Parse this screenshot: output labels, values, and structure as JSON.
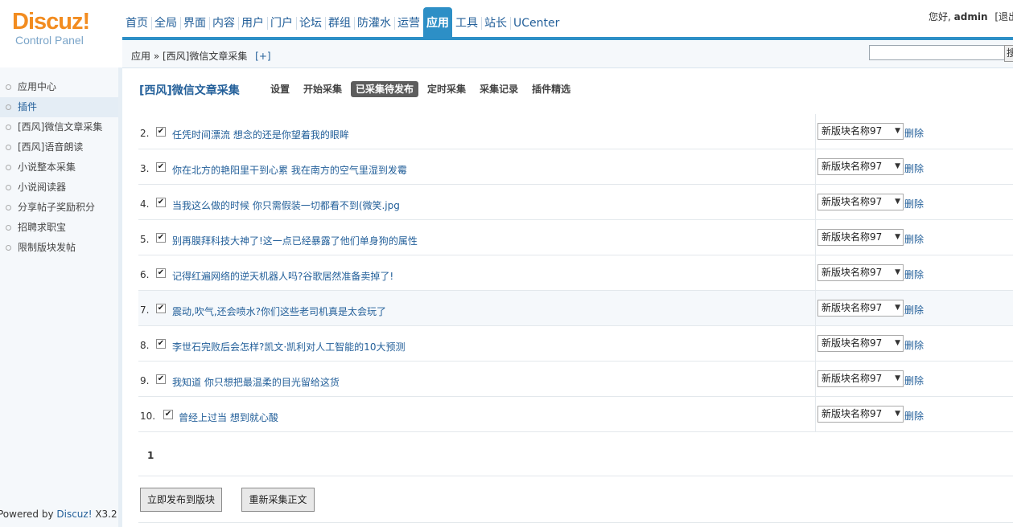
{
  "logo": {
    "main": "Discuz!",
    "sub": "Control Panel"
  },
  "topnav": [
    "首页",
    "全局",
    "界面",
    "内容",
    "用户",
    "门户",
    "论坛",
    "群组",
    "防灌水",
    "运营",
    "应用",
    "工具",
    "站长",
    "UCenter"
  ],
  "topnav_active": "应用",
  "user": {
    "greeting": "您好,",
    "name": "admin",
    "logout": "[退出"
  },
  "breadcrumb": {
    "path": "应用 » [西风]微信文章采集",
    "add": "[+]"
  },
  "search": {
    "value": "",
    "button": "搜"
  },
  "sidebar": {
    "items": [
      "应用中心",
      "插件",
      "[西风]微信文章采集",
      "[西风]语音朗读",
      "小说整本采集",
      "小说阅读器",
      "分享帖子奖励积分",
      "招聘求职宝",
      "限制版块发帖"
    ],
    "active": "插件"
  },
  "powered": {
    "prefix": "Powered by ",
    "brand": "Discuz!",
    "version": " X3.2"
  },
  "plugin": {
    "title": "[西风]微信文章采集",
    "tabs": [
      "设置",
      "开始采集",
      "已采集待发布",
      "定时采集",
      "采集记录",
      "插件精选"
    ],
    "active_tab": "已采集待发布"
  },
  "articles": [
    {
      "num": "2.",
      "checked": true,
      "title": "任凭时间漂流 想念的还是你望着我的眼眸",
      "block": "新版块名称97",
      "delete": "删除"
    },
    {
      "num": "3.",
      "checked": true,
      "title": "你在北方的艳阳里干到心累 我在南方的空气里湿到发霉",
      "block": "新版块名称97",
      "delete": "删除"
    },
    {
      "num": "4.",
      "checked": true,
      "title": "当我这么做的时候 你只需假装一切都看不到(微笑.jpg",
      "block": "新版块名称97",
      "delete": "删除"
    },
    {
      "num": "5.",
      "checked": true,
      "title": "别再膜拜科技大神了!这一点已经暴露了他们单身狗的属性",
      "block": "新版块名称97",
      "delete": "删除"
    },
    {
      "num": "6.",
      "checked": true,
      "title": "记得红遍网络的逆天机器人吗?谷歌居然准备卖掉了!",
      "block": "新版块名称97",
      "delete": "删除"
    },
    {
      "num": "7.",
      "checked": true,
      "title": "震动,吹气,还会喷水?你们这些老司机真是太会玩了",
      "block": "新版块名称97",
      "delete": "删除"
    },
    {
      "num": "8.",
      "checked": true,
      "title": "李世石完败后会怎样?凯文·凯利对人工智能的10大预测",
      "block": "新版块名称97",
      "delete": "删除"
    },
    {
      "num": "9.",
      "checked": true,
      "title": "我知道 你只想把最温柔的目光留给这货",
      "block": "新版块名称97",
      "delete": "删除"
    },
    {
      "num": "10.",
      "checked": true,
      "title": "曾经上过当 想到就心酸",
      "block": "新版块名称97",
      "delete": "删除"
    }
  ],
  "pager": {
    "current": "1"
  },
  "buttons": {
    "publish": "立即发布到版块",
    "recollect": "重新采集正文"
  }
}
